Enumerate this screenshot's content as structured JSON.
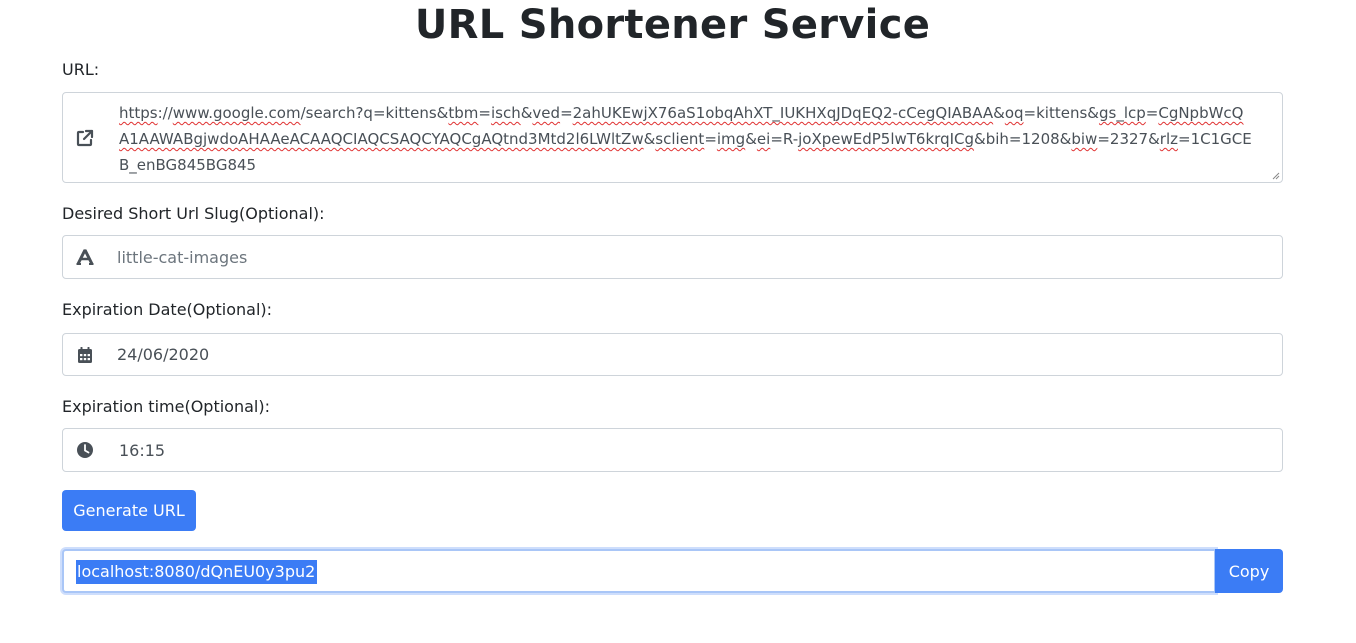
{
  "page": {
    "title": "URL Shortener Service"
  },
  "form": {
    "url_label": "URL:",
    "url_parts": [
      {
        "t": "https",
        "sq": true
      },
      {
        "t": "://",
        "sq": false
      },
      {
        "t": "www.google.com",
        "sq": true
      },
      {
        "t": "/search?q=kittens&",
        "sq": false
      },
      {
        "t": "tbm",
        "sq": true
      },
      {
        "t": "=",
        "sq": false
      },
      {
        "t": "isch",
        "sq": true
      },
      {
        "t": "&",
        "sq": false
      },
      {
        "t": "ved",
        "sq": true
      },
      {
        "t": "=",
        "sq": false
      },
      {
        "t": "2ahUKEwjX76aS1obqAhXT_IUKHXqJDqEQ2-cCegQIABAA",
        "sq": true
      },
      {
        "t": "&",
        "sq": false
      },
      {
        "t": "oq",
        "sq": true
      },
      {
        "t": "=kittens&",
        "sq": false
      },
      {
        "t": "gs_lcp",
        "sq": true
      },
      {
        "t": "=",
        "sq": false
      },
      {
        "t": "CgNpbWcQA1AAWABgjwdoAHAAeACAAQCIAQCSAQCYAQCgAQtnd3Mtd2l6LWltZw",
        "sq": true
      },
      {
        "t": "&",
        "sq": false
      },
      {
        "t": "sclient",
        "sq": true
      },
      {
        "t": "=",
        "sq": false
      },
      {
        "t": "img",
        "sq": true
      },
      {
        "t": "&",
        "sq": false
      },
      {
        "t": "ei",
        "sq": true
      },
      {
        "t": "=R-",
        "sq": false
      },
      {
        "t": "joXpewEdP5lwT6krqICg",
        "sq": true
      },
      {
        "t": "&bih=1208&",
        "sq": false
      },
      {
        "t": "biw",
        "sq": true
      },
      {
        "t": "=2327&",
        "sq": false
      },
      {
        "t": "rlz",
        "sq": true
      },
      {
        "t": "=1C1GCEB_enBG845BG845",
        "sq": false
      }
    ],
    "slug_label": "Desired Short Url Slug(Optional):",
    "slug_placeholder": "little-cat-images",
    "date_label": "Expiration Date(Optional):",
    "date_value": "24/06/2020",
    "time_label": "Expiration time(Optional):",
    "time_value": "16:15",
    "generate_label": "Generate URL"
  },
  "result": {
    "short_url": "localhost:8080/dQnEU0y3pu2",
    "copy_label": "Copy"
  },
  "icons": {
    "url": "external-link-icon",
    "slug": "font-icon",
    "date": "calendar-icon",
    "time": "clock-icon"
  },
  "colors": {
    "primary": "#3b7cf5",
    "icon": "#495057",
    "border": "#ced4da",
    "spellcheck": "#e03131"
  }
}
